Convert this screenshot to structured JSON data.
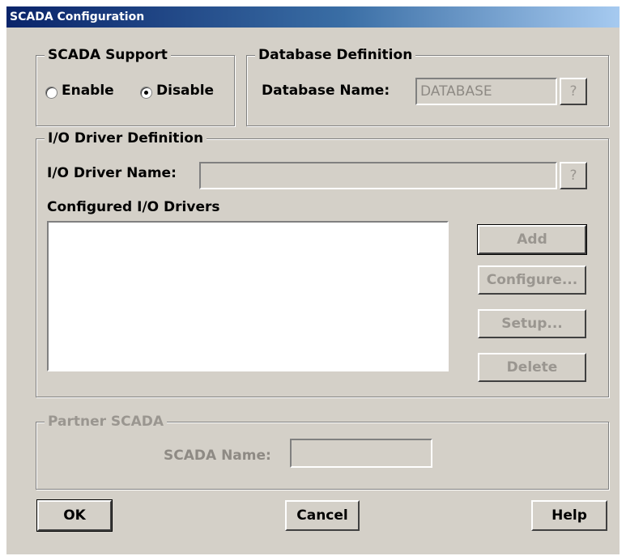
{
  "window": {
    "title": "SCADA Configuration"
  },
  "scada_support": {
    "legend": "SCADA Support",
    "enable_label": "Enable",
    "disable_label": "Disable",
    "selected": "Disable"
  },
  "database": {
    "legend": "Database Definition",
    "name_label": "Database Name:",
    "name_value": "DATABASE",
    "browse_label": "?"
  },
  "io_driver": {
    "legend": "I/O Driver Definition",
    "name_label": "I/O Driver Name:",
    "name_value": "",
    "browse_label": "?",
    "list_label": "Configured I/O Drivers",
    "drivers": [],
    "buttons": {
      "add": "Add",
      "configure": "Configure...",
      "setup": "Setup...",
      "delete": "Delete"
    }
  },
  "partner": {
    "legend": "Partner SCADA",
    "name_label": "SCADA Name:",
    "name_value": ""
  },
  "footer": {
    "ok": "OK",
    "cancel": "Cancel",
    "help": "Help"
  }
}
